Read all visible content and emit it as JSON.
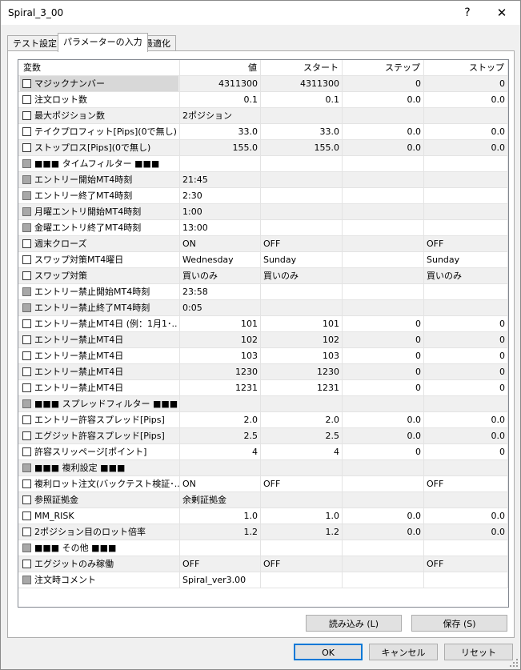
{
  "window": {
    "title": "Spiral_3_00",
    "help": "?",
    "close": "✕"
  },
  "tabs": [
    "テスト設定",
    "パラメーターの入力",
    "最適化"
  ],
  "columns": [
    "変数",
    "値",
    "スタート",
    "ステップ",
    "ストップ"
  ],
  "rows": [
    {
      "name": "マジックナンバー",
      "value": "4311300",
      "start": "4311300",
      "step": "0",
      "stop": "0",
      "numeric": true
    },
    {
      "name": "注文ロット数",
      "value": "0.1",
      "start": "0.1",
      "step": "0.0",
      "stop": "0.0",
      "numeric": true
    },
    {
      "name": "最大ポジション数",
      "value": "2ポジション",
      "start": "",
      "step": "",
      "stop": "",
      "numeric": false
    },
    {
      "name": "テイクプロフィット[Pips](0で無し)",
      "value": "33.0",
      "start": "33.0",
      "step": "0.0",
      "stop": "0.0",
      "numeric": true
    },
    {
      "name": "ストップロス[Pips](0で無し)",
      "value": "155.0",
      "start": "155.0",
      "step": "0.0",
      "stop": "0.0",
      "numeric": true
    },
    {
      "name": "■■■ タイムフィルター ■■■",
      "value": "",
      "start": "",
      "step": "",
      "stop": "",
      "numeric": false,
      "dim": true
    },
    {
      "name": "エントリー開始MT4時刻",
      "value": "21:45",
      "start": "",
      "step": "",
      "stop": "",
      "numeric": false,
      "dim": true
    },
    {
      "name": "エントリー終了MT4時刻",
      "value": "2:30",
      "start": "",
      "step": "",
      "stop": "",
      "numeric": false,
      "dim": true
    },
    {
      "name": "月曜エントリ開始MT4時刻",
      "value": "1:00",
      "start": "",
      "step": "",
      "stop": "",
      "numeric": false,
      "dim": true
    },
    {
      "name": "金曜エントリ終了MT4時刻",
      "value": "13:00",
      "start": "",
      "step": "",
      "stop": "",
      "numeric": false,
      "dim": true
    },
    {
      "name": "週末クローズ",
      "value": "ON",
      "start": "OFF",
      "step": "",
      "stop": "OFF",
      "numeric": false
    },
    {
      "name": "スワップ対策MT4曜日",
      "value": "Wednesday",
      "start": "Sunday",
      "step": "",
      "stop": "Sunday",
      "numeric": false
    },
    {
      "name": "スワップ対策",
      "value": "買いのみ",
      "start": "買いのみ",
      "step": "",
      "stop": "買いのみ",
      "numeric": false
    },
    {
      "name": "エントリー禁止開始MT4時刻",
      "value": "23:58",
      "start": "",
      "step": "",
      "stop": "",
      "numeric": false,
      "dim": true
    },
    {
      "name": "エントリー禁止終了MT4時刻",
      "value": "0:05",
      "start": "",
      "step": "",
      "stop": "",
      "numeric": false,
      "dim": true
    },
    {
      "name": "エントリー禁止MT4日 (例：1月1･..",
      "value": "101",
      "start": "101",
      "step": "0",
      "stop": "0",
      "numeric": true
    },
    {
      "name": "エントリー禁止MT4日",
      "value": "102",
      "start": "102",
      "step": "0",
      "stop": "0",
      "numeric": true
    },
    {
      "name": "エントリー禁止MT4日",
      "value": "103",
      "start": "103",
      "step": "0",
      "stop": "0",
      "numeric": true
    },
    {
      "name": "エントリー禁止MT4日",
      "value": "1230",
      "start": "1230",
      "step": "0",
      "stop": "0",
      "numeric": true
    },
    {
      "name": "エントリー禁止MT4日",
      "value": "1231",
      "start": "1231",
      "step": "0",
      "stop": "0",
      "numeric": true
    },
    {
      "name": "■■■ スプレッドフィルター ■■■",
      "value": "",
      "start": "",
      "step": "",
      "stop": "",
      "numeric": false,
      "dim": true
    },
    {
      "name": "エントリー許容スプレッド[Pips]",
      "value": "2.0",
      "start": "2.0",
      "step": "0.0",
      "stop": "0.0",
      "numeric": true
    },
    {
      "name": "エグジット許容スプレッド[Pips]",
      "value": "2.5",
      "start": "2.5",
      "step": "0.0",
      "stop": "0.0",
      "numeric": true
    },
    {
      "name": "許容スリッページ[ポイント]",
      "value": "4",
      "start": "4",
      "step": "0",
      "stop": "0",
      "numeric": true
    },
    {
      "name": "■■■ 複利設定 ■■■",
      "value": "",
      "start": "",
      "step": "",
      "stop": "",
      "numeric": false,
      "dim": true
    },
    {
      "name": "複利ロット注文(バックテスト検証･..",
      "value": "ON",
      "start": "OFF",
      "step": "",
      "stop": "OFF",
      "numeric": false
    },
    {
      "name": "参照証拠金",
      "value": "余剰証拠金",
      "start": "",
      "step": "",
      "stop": "",
      "numeric": false
    },
    {
      "name": "MM_RISK",
      "value": "1.0",
      "start": "1.0",
      "step": "0.0",
      "stop": "0.0",
      "numeric": true
    },
    {
      "name": "2ポジション目のロット倍率",
      "value": "1.2",
      "start": "1.2",
      "step": "0.0",
      "stop": "0.0",
      "numeric": true
    },
    {
      "name": "■■■ その他 ■■■",
      "value": "",
      "start": "",
      "step": "",
      "stop": "",
      "numeric": false,
      "dim": true
    },
    {
      "name": "エグジットのみ稼働",
      "value": "OFF",
      "start": "OFF",
      "step": "",
      "stop": "OFF",
      "numeric": false
    },
    {
      "name": "注文時コメント",
      "value": "Spiral_ver3.00",
      "start": "",
      "step": "",
      "stop": "",
      "numeric": false,
      "dim": true
    }
  ],
  "buttons": {
    "load": "読み込み (L)",
    "save": "保存 (S)",
    "ok": "OK",
    "cancel": "キャンセル",
    "reset": "リセット"
  }
}
